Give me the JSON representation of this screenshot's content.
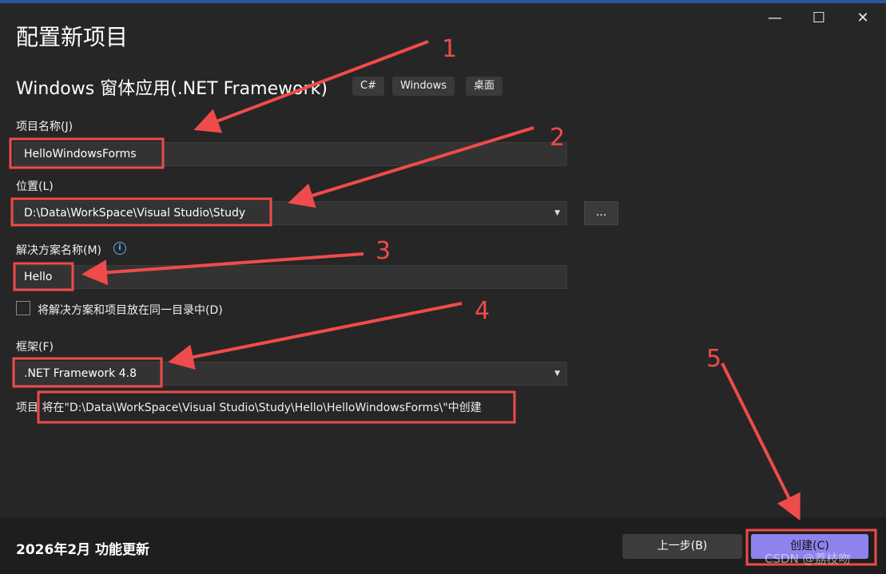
{
  "window": {
    "title": "配置新项目",
    "subtitle": "Windows 窗体应用(.NET Framework)",
    "tags": [
      "C#",
      "Windows",
      "桌面"
    ],
    "controls": {
      "minimize": "—",
      "maximize": "☐",
      "close": "✕"
    }
  },
  "form": {
    "project_name": {
      "label": "项目名称(J)",
      "value": "HelloWindowsForms"
    },
    "location": {
      "label": "位置(L)",
      "value": "D:\\Data\\WorkSpace\\Visual Studio\\Study",
      "browse_label": "..."
    },
    "solution_name": {
      "label": "解决方案名称(M)",
      "value": "Hello",
      "info_icon": "i"
    },
    "same_directory": {
      "label": "将解决方案和项目放在同一目录中(D)",
      "checked": false
    },
    "framework": {
      "label": "框架(F)",
      "value": ".NET Framework 4.8"
    },
    "path_note": "项目 将在\"D:\\Data\\WorkSpace\\Visual Studio\\Study\\Hello\\HelloWindowsForms\\\"中创建"
  },
  "footer": {
    "update_text": "2026年2月 功能更新",
    "back_label": "上一步(B)",
    "create_label": "创建(C)"
  },
  "annotations": {
    "numbers": [
      "1",
      "2",
      "3",
      "4",
      "5"
    ],
    "color": "#ef4b4b"
  },
  "watermark": "CSDN @荔枝吻",
  "colors": {
    "background": "#262626",
    "accent": "#8e82ec",
    "annotation": "#ef4b4b"
  }
}
